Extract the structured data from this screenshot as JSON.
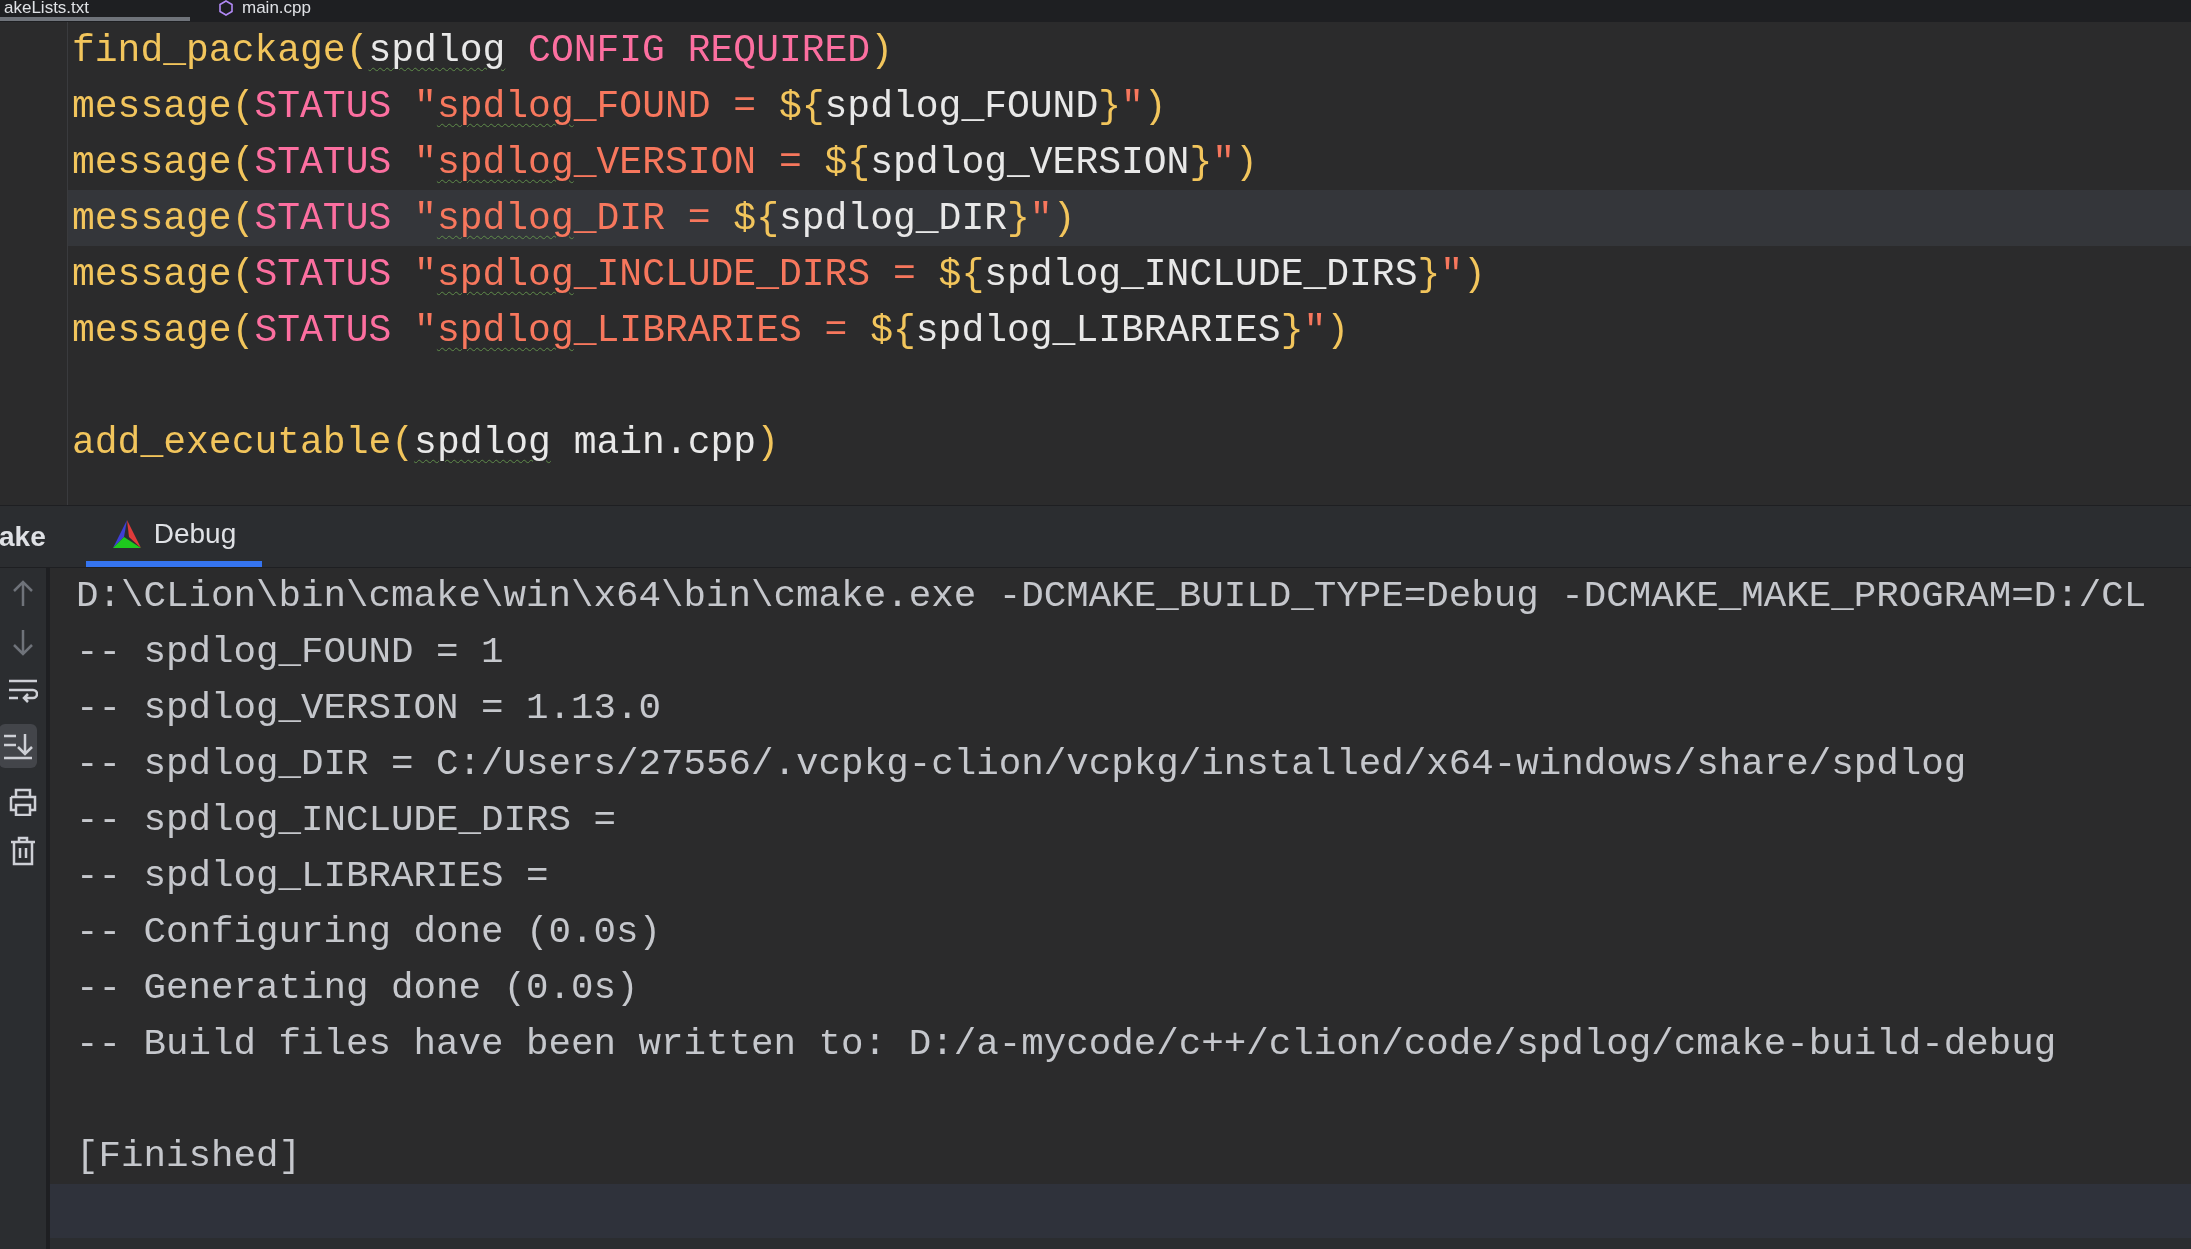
{
  "editor_tabs": [
    {
      "label": "akeLists.txt",
      "selected": true
    },
    {
      "label": "main.cpp",
      "selected": false
    }
  ],
  "code_lines": [
    {
      "current": false,
      "tokens": [
        {
          "text": "find_package",
          "kind": "func"
        },
        {
          "text": "(",
          "kind": "paren"
        },
        {
          "text": "spdlog",
          "kind": "ident_flagged"
        },
        {
          "text": " CONFIG REQUIRED",
          "kind": "keyword"
        },
        {
          "text": ")",
          "kind": "paren"
        }
      ]
    },
    {
      "current": false,
      "tokens": [
        {
          "text": "message",
          "kind": "func"
        },
        {
          "text": "(",
          "kind": "paren"
        },
        {
          "text": "STATUS",
          "kind": "keyword"
        },
        {
          "text": " \"",
          "kind": "string"
        },
        {
          "text": "spdlog",
          "kind": "string_flagged"
        },
        {
          "text": "_FOUND = ",
          "kind": "string"
        },
        {
          "text": "${",
          "kind": "interp"
        },
        {
          "text": "spdlog_FOUND",
          "kind": "ident"
        },
        {
          "text": "}",
          "kind": "interp"
        },
        {
          "text": "\"",
          "kind": "string"
        },
        {
          "text": ")",
          "kind": "paren"
        }
      ]
    },
    {
      "current": false,
      "tokens": [
        {
          "text": "message",
          "kind": "func"
        },
        {
          "text": "(",
          "kind": "paren"
        },
        {
          "text": "STATUS",
          "kind": "keyword"
        },
        {
          "text": " \"",
          "kind": "string"
        },
        {
          "text": "spdlog",
          "kind": "string_flagged"
        },
        {
          "text": "_VERSION = ",
          "kind": "string"
        },
        {
          "text": "${",
          "kind": "interp"
        },
        {
          "text": "spdlog_VERSION",
          "kind": "ident"
        },
        {
          "text": "}",
          "kind": "interp"
        },
        {
          "text": "\"",
          "kind": "string"
        },
        {
          "text": ")",
          "kind": "paren"
        }
      ]
    },
    {
      "current": true,
      "tokens": [
        {
          "text": "message",
          "kind": "func"
        },
        {
          "text": "(",
          "kind": "paren"
        },
        {
          "text": "STATUS",
          "kind": "keyword"
        },
        {
          "text": " \"",
          "kind": "string"
        },
        {
          "text": "spdlog",
          "kind": "string_flagged"
        },
        {
          "text": "_DIR = ",
          "kind": "string"
        },
        {
          "text": "${",
          "kind": "interp"
        },
        {
          "text": "spdlog_DIR",
          "kind": "ident"
        },
        {
          "text": "}",
          "kind": "interp"
        },
        {
          "text": "\"",
          "kind": "string"
        },
        {
          "text": ")",
          "kind": "paren"
        }
      ]
    },
    {
      "current": false,
      "tokens": [
        {
          "text": "message",
          "kind": "func"
        },
        {
          "text": "(",
          "kind": "paren"
        },
        {
          "text": "STATUS",
          "kind": "keyword"
        },
        {
          "text": " \"",
          "kind": "string"
        },
        {
          "text": "spdlog",
          "kind": "string_flagged"
        },
        {
          "text": "_INCLUDE_DIRS = ",
          "kind": "string"
        },
        {
          "text": "${",
          "kind": "interp"
        },
        {
          "text": "spdlog_INCLUDE_DIRS",
          "kind": "ident"
        },
        {
          "text": "}",
          "kind": "interp"
        },
        {
          "text": "\"",
          "kind": "string"
        },
        {
          "text": ")",
          "kind": "paren"
        }
      ]
    },
    {
      "current": false,
      "tokens": [
        {
          "text": "message",
          "kind": "func"
        },
        {
          "text": "(",
          "kind": "paren"
        },
        {
          "text": "STATUS",
          "kind": "keyword"
        },
        {
          "text": " \"",
          "kind": "string"
        },
        {
          "text": "spdlog",
          "kind": "string_flagged"
        },
        {
          "text": "_LIBRARIES = ",
          "kind": "string"
        },
        {
          "text": "${",
          "kind": "interp"
        },
        {
          "text": "spdlog_LIBRARIES",
          "kind": "ident"
        },
        {
          "text": "}",
          "kind": "interp"
        },
        {
          "text": "\"",
          "kind": "string"
        },
        {
          "text": ")",
          "kind": "paren"
        }
      ]
    },
    {
      "current": false
    },
    {
      "current": false,
      "tokens": [
        {
          "text": "add_executable",
          "kind": "func"
        },
        {
          "text": "(",
          "kind": "paren"
        },
        {
          "text": "spdlog",
          "kind": "ident_flagged"
        },
        {
          "text": " main.cpp",
          "kind": "ident"
        },
        {
          "text": ")",
          "kind": "paren"
        }
      ]
    }
  ],
  "tool_window": {
    "title": "ake",
    "tabs": [
      {
        "label": "Debug",
        "selected": true
      }
    ]
  },
  "console_toolbar": {
    "scroll_to_end_on": true
  },
  "console_lines": [
    "D:\\CLion\\bin\\cmake\\win\\x64\\bin\\cmake.exe -DCMAKE_BUILD_TYPE=Debug -DCMAKE_MAKE_PROGRAM=D:/CL",
    "-- spdlog_FOUND = 1",
    "-- spdlog_VERSION = 1.13.0",
    "-- spdlog_DIR = C:/Users/27556/.vcpkg-clion/vcpkg/installed/x64-windows/share/spdlog",
    "-- spdlog_INCLUDE_DIRS =",
    "-- spdlog_LIBRARIES =",
    "-- Configuring done (0.0s)",
    "-- Generating done (0.0s)",
    "-- Build files have been written to: D:/a-mycode/c++/clion/code/spdlog/cmake-build-debug"
  ],
  "console_footer": "[Finished]"
}
